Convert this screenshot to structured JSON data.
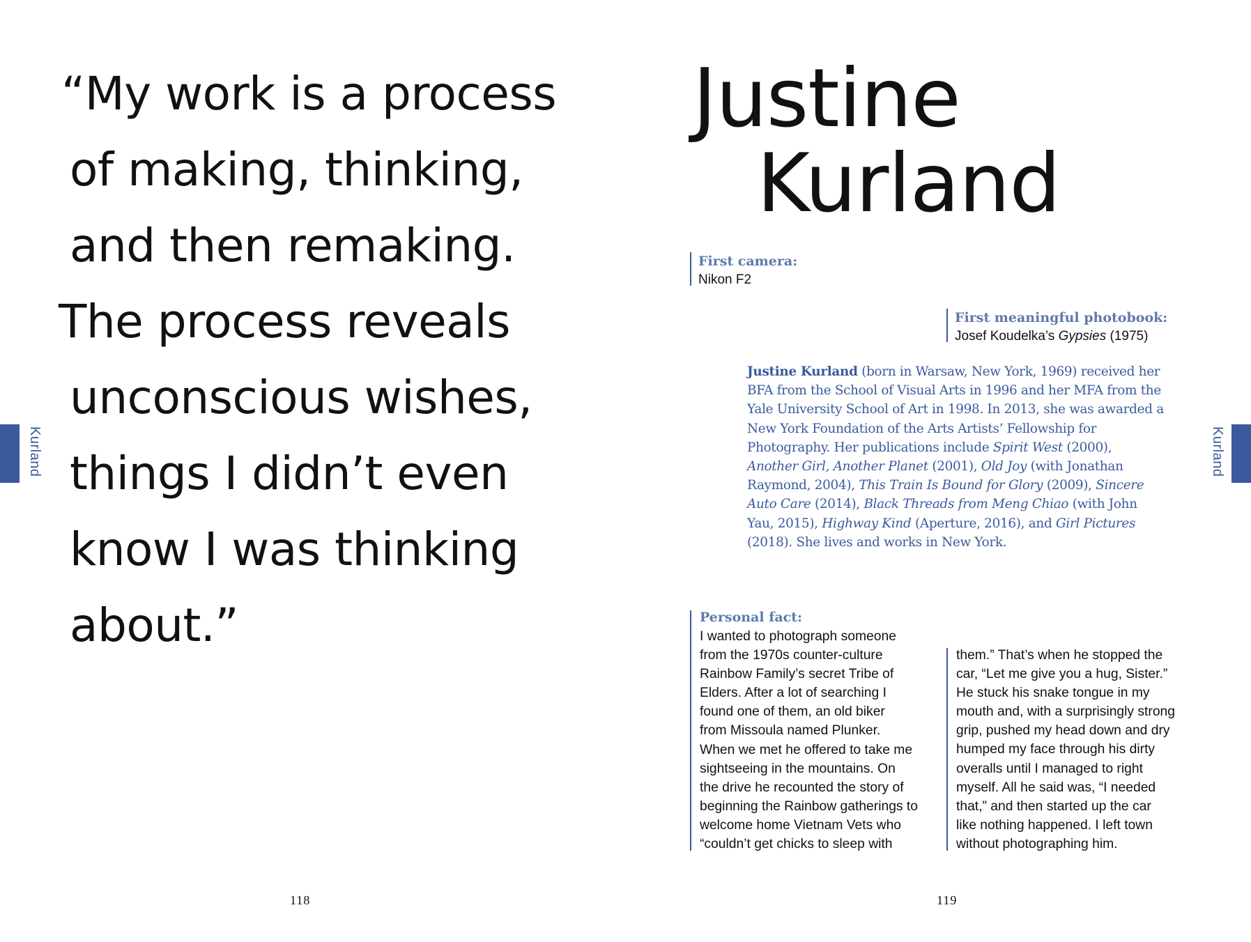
{
  "quote": {
    "lines": [
      "“My work is a process",
      "of making, thinking,",
      "and then remaking.",
      "The process reveals",
      "unconscious wishes,",
      "things I didn’t even",
      "know I was thinking",
      "about.”"
    ]
  },
  "side_label": "Kurland",
  "name": {
    "first": "Justine",
    "last": "Kurland"
  },
  "first_camera": {
    "label": "First camera:",
    "value": "Nikon F2"
  },
  "first_photobook": {
    "label": "First meaningful photobook:",
    "author": "Josef Koudelka’s ",
    "title": "Gypsies",
    "year": " (1975)"
  },
  "bio": {
    "name": "Justine Kurland",
    "p1": " (born in Warsaw, New York, 1969) received her BFA from the School of Visual Arts in 1996 and her MFA from the Yale University School of Art in 1998. In 2013, she was awarded a New York Foundation of the Arts Artists’ Fellowship for Photography. Her publications include ",
    "t1": "Spirit West",
    "p2": " (2000), ",
    "t2": "Another Girl, Another Planet",
    "p3": " (2001), ",
    "t3": "Old Joy",
    "p4": " (with Jonathan Raymond, 2004), ",
    "t4": "This Train Is Bound for Glory",
    "p5": " (2009), ",
    "t5": "Sincere Auto Care",
    "p6": " (2014), ",
    "t6": "Black Threads from Meng Chiao",
    "p7": " (with John Yau, 2015), ",
    "t7": "Highway Kind",
    "p8": " (Aperture, 2016), and ",
    "t8": "Girl Pictures",
    "p9": " (2018). She lives and works in New York."
  },
  "personal_fact": {
    "label": "Personal fact:",
    "col1": [
      "I wanted to photograph someone",
      "from the 1970s counter-culture",
      "Rainbow Family’s secret Tribe of",
      "Elders. After a lot of searching I",
      "found one of them, an old biker",
      "from Missoula named Plunker.",
      "When we met he offered to take me",
      "sightseeing in the mountains. On",
      "the drive he recounted the story of",
      "beginning the Rainbow gatherings to",
      "welcome home Vietnam Vets who",
      "“couldn’t get chicks to sleep with"
    ],
    "col2": [
      "them.” That’s when he stopped the",
      "car, “Let me give you a hug, Sister.”",
      "He stuck his snake tongue in my",
      "mouth and, with a surprisingly strong",
      "grip, pushed my head down and dry",
      "humped my face through his dirty",
      "overalls until I managed to right",
      "myself. All he said was, “I needed",
      "that,” and then started up the car",
      "like nothing happened. I left town",
      "without photographing him."
    ]
  },
  "folios": {
    "left": "118",
    "right": "119"
  }
}
